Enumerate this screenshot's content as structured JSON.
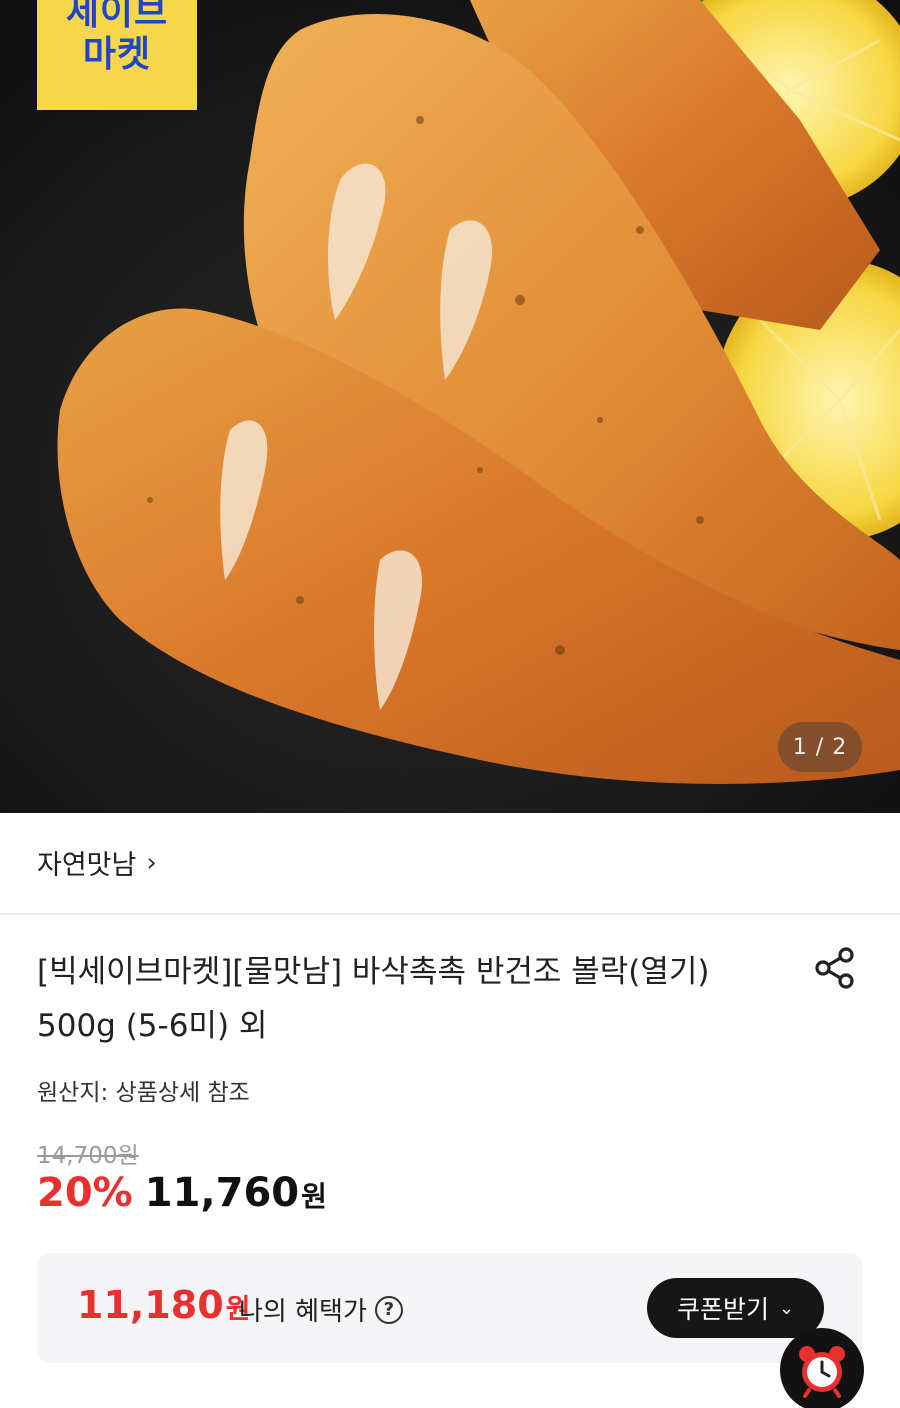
{
  "hero": {
    "badge_line1": "세이브",
    "badge_line2": "마켓",
    "page_indicator": "1 / 2"
  },
  "seller": {
    "name": "자연맛남",
    "chevron": "›"
  },
  "product": {
    "title": "[빅세이브마켓][물맛남] 바삭촉촉 반건조 볼락(열기) 500g (5-6미) 외",
    "origin": "원산지: 상품상세 참조",
    "original_price": "14,700원",
    "discount": "20%",
    "sale_price": "11,760",
    "sale_unit": "원"
  },
  "benefit": {
    "price": "11,180",
    "unit": "원",
    "label": "나의 혜택가",
    "help_symbol": "?",
    "coupon_button": "쿠폰받기",
    "coupon_chevron": "⌄"
  },
  "icons": {
    "share": "share-icon",
    "alarm": "alarm-clock-icon"
  },
  "colors": {
    "discount_red": "#e8312f",
    "badge_yellow": "#f6d64a",
    "badge_blue": "#1f46c8",
    "button_dark": "#161616"
  }
}
